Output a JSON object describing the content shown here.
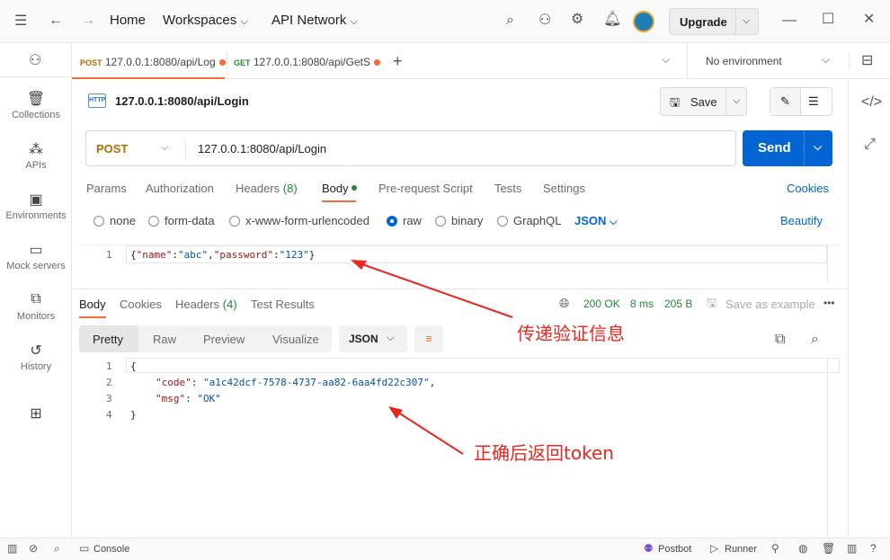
{
  "titlebar": {
    "home": "Home",
    "workspaces": "Workspaces",
    "api_network": "API Network",
    "upgrade": "Upgrade"
  },
  "sidebar": {
    "items": [
      {
        "label": "Collections",
        "icon": "collections-icon"
      },
      {
        "label": "APIs",
        "icon": "apis-icon"
      },
      {
        "label": "Environments",
        "icon": "environments-icon"
      },
      {
        "label": "Mock servers",
        "icon": "mock-servers-icon"
      },
      {
        "label": "Monitors",
        "icon": "monitors-icon"
      },
      {
        "label": "History",
        "icon": "history-icon"
      }
    ]
  },
  "tabs": [
    {
      "method": "POST",
      "label": "127.0.0.1:8080/api/Log"
    },
    {
      "method": "GET",
      "label": "127.0.0.1:8080/api/GetS"
    }
  ],
  "environment": "No environment",
  "request": {
    "title": "127.0.0.1:8080/api/Login",
    "method": "POST",
    "url": "127.0.0.1:8080/api/Login",
    "save": "Save",
    "send": "Send"
  },
  "req_tabs": {
    "params": "Params",
    "authorization": "Authorization",
    "headers": "Headers",
    "headers_count": "(8)",
    "body": "Body",
    "pre_request": "Pre-request Script",
    "tests": "Tests",
    "settings": "Settings",
    "cookies": "Cookies"
  },
  "body_options": {
    "none": "none",
    "form_data": "form-data",
    "urlencoded": "x-www-form-urlencoded",
    "raw": "raw",
    "binary": "binary",
    "graphql": "GraphQL",
    "json": "JSON",
    "beautify": "Beautify"
  },
  "request_body": {
    "line": "1",
    "t1": "{",
    "k1": "\"name\"",
    "c1": ":",
    "v1": "\"abc\"",
    "c2": ",",
    "k2": "\"password\"",
    "c3": ":",
    "v2": "\"123\"",
    "t2": "}"
  },
  "res_tabs": {
    "body": "Body",
    "cookies": "Cookies",
    "headers": "Headers",
    "headers_count": "(4)",
    "test_results": "Test Results"
  },
  "res_status": {
    "status": "200 OK",
    "time": "8 ms",
    "size": "205 B",
    "save_example": "Save as example"
  },
  "res_view": {
    "pretty": "Pretty",
    "raw": "Raw",
    "preview": "Preview",
    "visualize": "Visualize",
    "format": "JSON"
  },
  "response_body": {
    "l1": "1",
    "l2": "2",
    "l3": "3",
    "l4": "4",
    "open": "{",
    "k_code": "\"code\"",
    "v_code": "\"a1c42dcf-7578-4737-aa82-6aa4fd22c307\"",
    "k_msg": "\"msg\"",
    "v_msg": "\"OK\"",
    "colon": ": ",
    "comma": ",",
    "close": "}"
  },
  "annotations": {
    "a1": "传递验证信息",
    "a2": "正确后返回token"
  },
  "statusbar": {
    "console": "Console",
    "postbot": "Postbot",
    "runner": "Runner"
  }
}
